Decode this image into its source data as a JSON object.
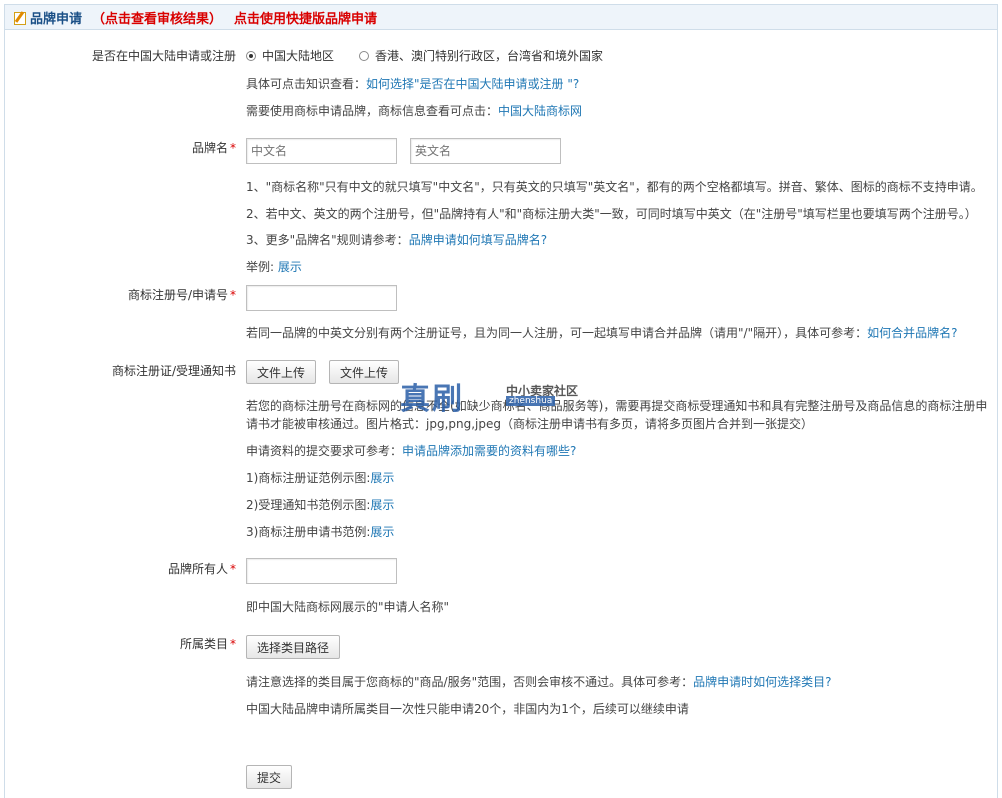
{
  "header": {
    "title": "品牌申请",
    "check_result": "（点击查看审核结果）",
    "quick_apply": "点击使用快捷版品牌申请"
  },
  "region": {
    "label": "是否在中国大陆申请或注册",
    "option_mainland": "中国大陆地区",
    "option_other": "香港、澳门特别行政区，台湾省和境外国家",
    "hint1_prefix": "具体可点击知识查看：",
    "hint1_link": "如何选择\"是否在中国大陆申请或注册 \"?",
    "hint2_prefix": "需要使用商标申请品牌，商标信息查看可点击：",
    "hint2_link": "中国大陆商标网"
  },
  "brand_name": {
    "label": "品牌名",
    "required": "*",
    "cn_placeholder": "中文名",
    "en_placeholder": "英文名",
    "note1": "1、\"商标名称\"只有中文的就只填写\"中文名\"，只有英文的只填写\"英文名\"，都有的两个空格都填写。拼音、繁体、图标的商标不支持申请。",
    "note2": "2、若中文、英文的两个注册号，但\"品牌持有人\"和\"商标注册大类\"一致，可同时填写中英文（在\"注册号\"填写栏里也要填写两个注册号。）",
    "note3_prefix": "3、更多\"品牌名\"规则请参考：",
    "note3_link": "品牌申请如何填写品牌名?",
    "example_prefix": "举例:",
    "example_link": "展示"
  },
  "reg_no": {
    "label": "商标注册号/申请号",
    "required": "*",
    "value": "",
    "note_prefix": "若同一品牌的中英文分别有两个注册证号，且为同一人注册，可一起填写申请合并品牌（请用\"/\"隔开），具体可参考：",
    "note_link": "如何合并品牌名?"
  },
  "certificate": {
    "label": "商标注册证/受理通知书",
    "upload1": "文件上传",
    "upload2": "文件上传",
    "note_line1": "若您的商标注册号在商标网的信息不全(如缺少商标名、商品服务等)，需要再提交商标受理通知书和具有完整注册号及商品信息的商标注册申",
    "note_line2": "请书才能被审核通过。图片格式：jpg,png,jpeg（商标注册申请书有多页，请将多页图片合并到一张提交）",
    "req_prefix": "申请资料的提交要求可参考：",
    "req_link": "申请品牌添加需要的资料有哪些?",
    "ex1_prefix": "1)商标注册证范例示图:",
    "ex1_link": "展示",
    "ex2_prefix": "2)受理通知书范例示图:",
    "ex2_link": "展示",
    "ex3_prefix": "3)商标注册申请书范例:",
    "ex3_link": "展示"
  },
  "owner": {
    "label": "品牌所有人",
    "required": "*",
    "value": "",
    "note": "即中国大陆商标网展示的\"申请人名称\""
  },
  "category": {
    "label": "所属类目",
    "required": "*",
    "button": "选择类目路径",
    "note1_prefix": "请注意选择的类目属于您商标的\"商品/服务\"范围，否则会审核不通过。具体可参考：",
    "note1_link": "品牌申请时如何选择类目?",
    "note2": "中国大陆品牌申请所属类目一次性只能申请20个，非国内为1个，后续可以继续申请"
  },
  "submit": "提交",
  "watermark": {
    "big": "真刷",
    "small": "中小卖家社区",
    "domain": "zhenshua"
  },
  "colors": {
    "link": "#1f77b4",
    "required": "#d90000",
    "header_title": "#1a4f86"
  }
}
